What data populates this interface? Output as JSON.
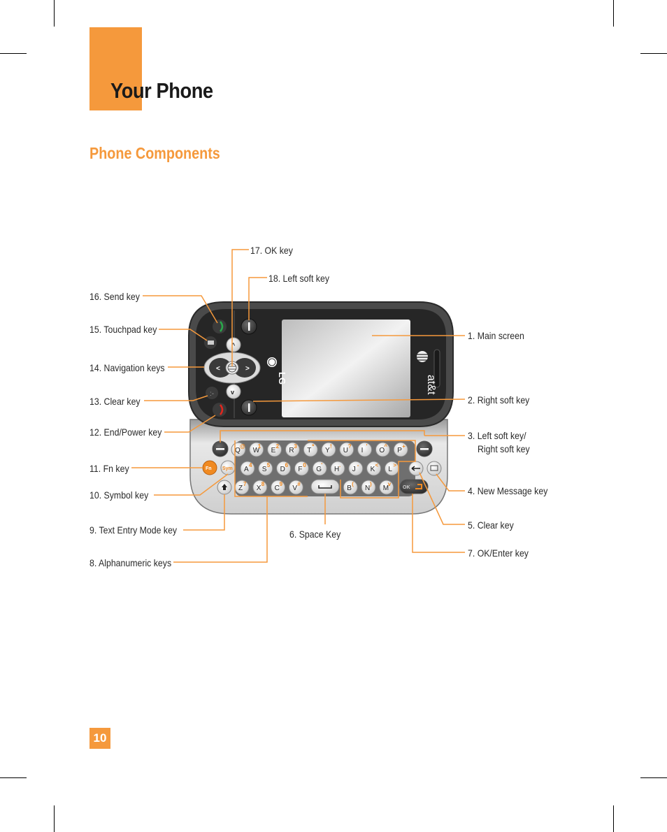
{
  "header": {
    "title": "Your Phone",
    "section_title": "Phone Components"
  },
  "callouts": [
    {
      "id": "main-screen",
      "text": "1. Main screen"
    },
    {
      "id": "right-soft-key",
      "text": "2. Right soft key"
    },
    {
      "id": "left-right-soft-key",
      "text": "3. Left soft key/",
      "text2": "Right soft key"
    },
    {
      "id": "new-message-key",
      "text": "4. New Message key"
    },
    {
      "id": "clear-key-5",
      "text": "5. Clear key"
    },
    {
      "id": "space-key",
      "text": "6. Space Key"
    },
    {
      "id": "ok-enter-key",
      "text": "7. OK/Enter key"
    },
    {
      "id": "alphanumeric-keys",
      "text": "8. Alphanumeric keys"
    },
    {
      "id": "text-entry-mode-key",
      "text": "9. Text Entry Mode key"
    },
    {
      "id": "symbol-key",
      "text": "10. Symbol key"
    },
    {
      "id": "fn-key",
      "text": "11. Fn key"
    },
    {
      "id": "end-power-key",
      "text": "12. End/Power key"
    },
    {
      "id": "clear-key-13",
      "text": "13. Clear key"
    },
    {
      "id": "navigation-keys",
      "text": "14. Navigation keys"
    },
    {
      "id": "touchpad-key",
      "text": "15. Touchpad key"
    },
    {
      "id": "send-key",
      "text": "16. Send key"
    },
    {
      "id": "ok-key",
      "text": "17. OK key"
    },
    {
      "id": "left-soft-key",
      "text": "18. Left soft key"
    }
  ],
  "phone": {
    "brand": "LG",
    "carrier": "at&t",
    "keyboard_rows": [
      [
        [
          "Q",
          "@"
        ],
        [
          "W",
          "1"
        ],
        [
          "E",
          "2"
        ],
        [
          "R",
          "3"
        ],
        [
          "T",
          "*"
        ],
        [
          "Y",
          "!"
        ],
        [
          "U",
          "?"
        ],
        [
          "I",
          "'"
        ],
        [
          "O",
          "^"
        ],
        [
          "P",
          "+"
        ]
      ],
      [
        [
          "A",
          "4"
        ],
        [
          "S",
          "5"
        ],
        [
          "D",
          "6"
        ],
        [
          "F",
          "0"
        ],
        [
          "G",
          "'"
        ],
        [
          "H",
          "."
        ],
        [
          "J",
          "-"
        ],
        [
          "K",
          "<"
        ],
        [
          "L",
          ">"
        ]
      ],
      [
        [
          "Z",
          "7"
        ],
        [
          "X",
          "8"
        ],
        [
          "C",
          "9"
        ],
        [
          "V",
          "#"
        ],
        [
          "B",
          "("
        ],
        [
          "N",
          ")"
        ],
        [
          "M",
          "v"
        ]
      ]
    ],
    "fn_label": "Fn",
    "sym_label": "Sym",
    "ok_label": "OK"
  },
  "colors": {
    "accent": "#f5993c",
    "body_dark": "#2b2b2b",
    "keyboard": "#d9d9d9"
  },
  "page_number": "10"
}
